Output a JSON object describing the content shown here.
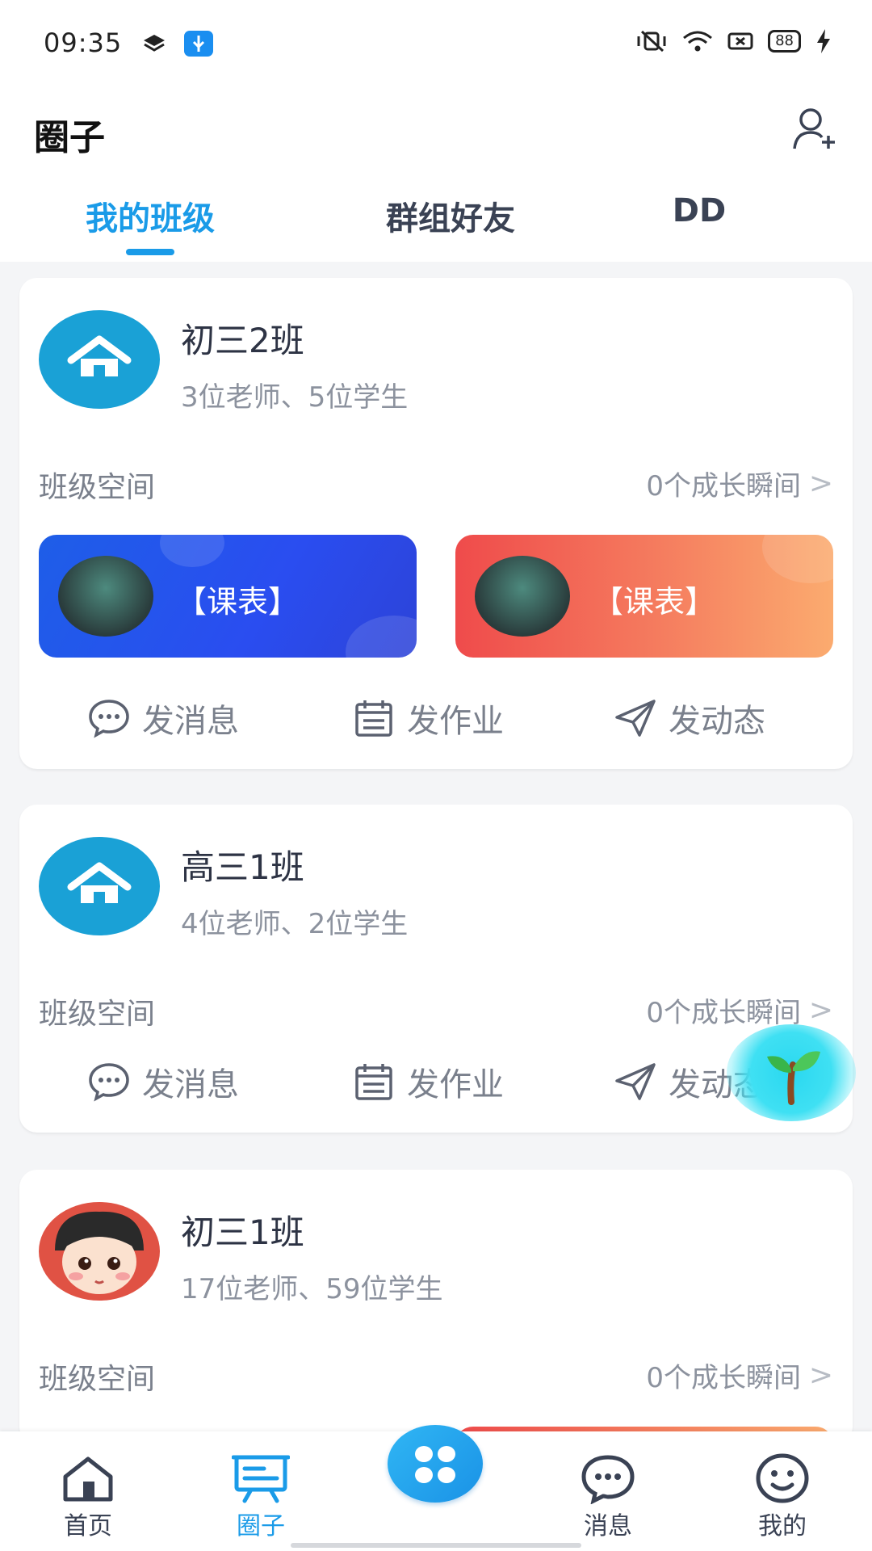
{
  "status_bar": {
    "time": "09:35",
    "battery": "88"
  },
  "header": {
    "title": "圈子"
  },
  "tabs": [
    {
      "label": "我的班级",
      "active": true
    },
    {
      "label": "群组好友",
      "active": false
    },
    {
      "label": "DD",
      "active": false
    }
  ],
  "cards": [
    {
      "name": "初三2班",
      "sub": "3位老师、5位学生",
      "space_label": "班级空间",
      "moments": "0个成长瞬间",
      "banners": [
        "【课表】",
        "【课表】"
      ],
      "actions": [
        "发消息",
        "发作业",
        "发动态"
      ]
    },
    {
      "name": "高三1班",
      "sub": "4位老师、2位学生",
      "space_label": "班级空间",
      "moments": "0个成长瞬间",
      "actions": [
        "发消息",
        "发作业",
        "发动态"
      ]
    },
    {
      "name": "初三1班",
      "sub": "17位老师、59位学生",
      "space_label": "班级空间",
      "moments": "0个成长瞬间"
    }
  ],
  "bottom_nav": [
    {
      "label": "首页",
      "icon": "home-icon"
    },
    {
      "label": "圈子",
      "icon": "circle-board-icon",
      "active": true
    },
    {
      "label": "",
      "icon": "apps-icon"
    },
    {
      "label": "消息",
      "icon": "message-icon"
    },
    {
      "label": "我的",
      "icon": "profile-icon"
    }
  ],
  "colors": {
    "accent": "#1a9be8",
    "banner_blue": "#2a4df0",
    "banner_orange": "#f57d5f",
    "avatar_teal": "#1aa1d6"
  }
}
